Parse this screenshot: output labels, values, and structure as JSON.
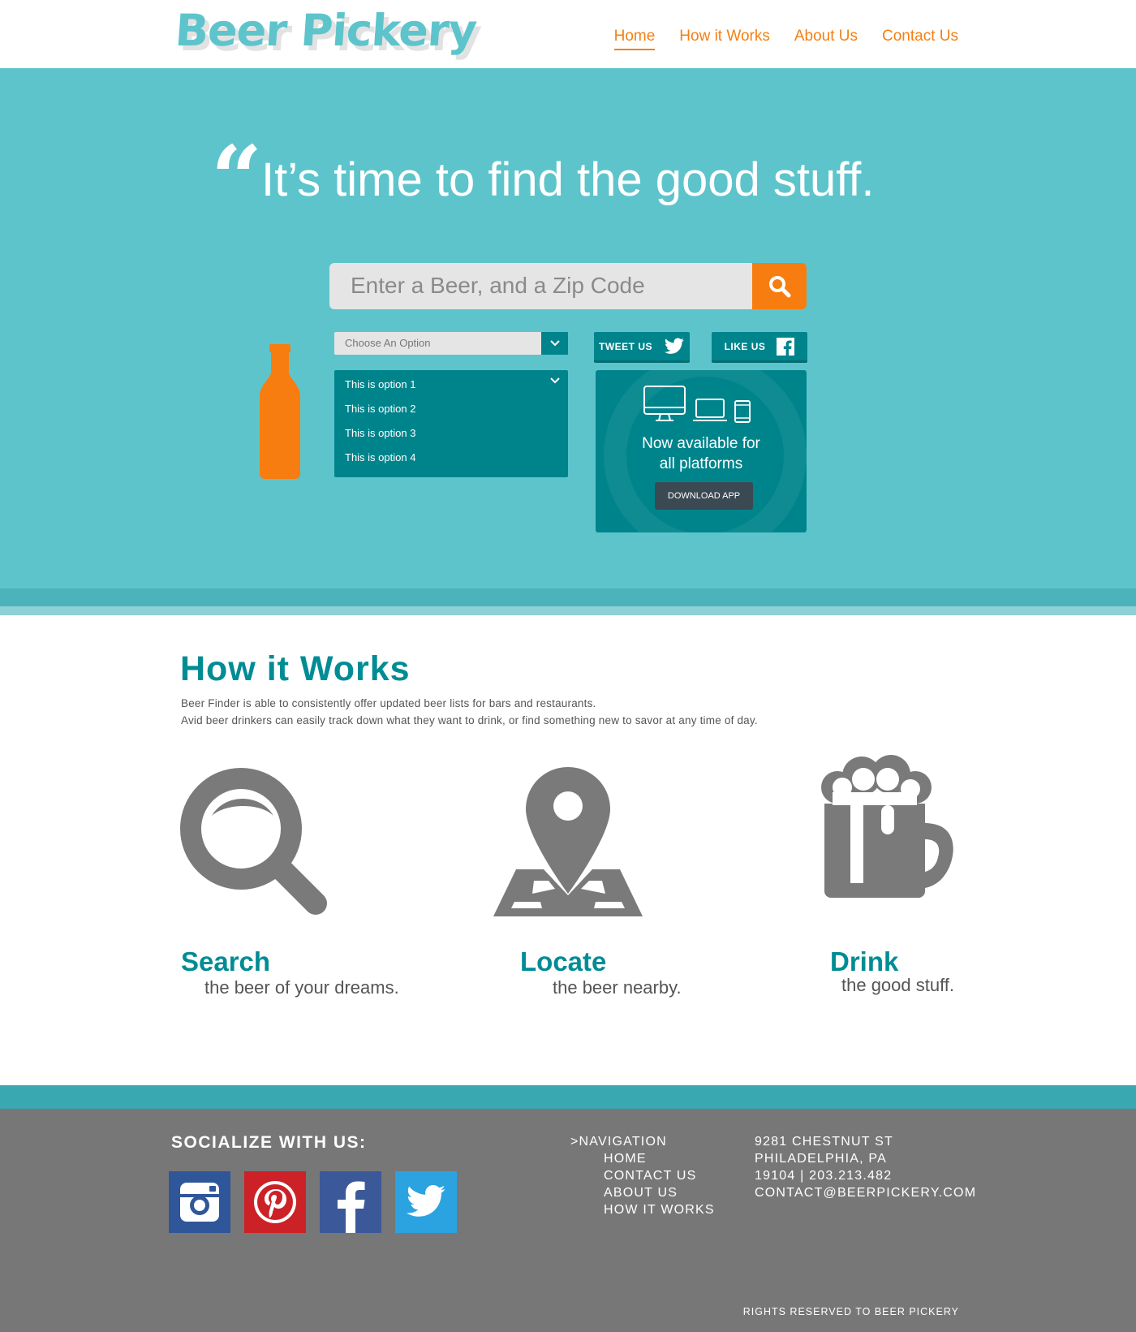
{
  "header": {
    "logo": "Beer Pickery",
    "nav": [
      {
        "label": "Home",
        "active": true
      },
      {
        "label": "How it Works",
        "active": false
      },
      {
        "label": "About Us",
        "active": false
      },
      {
        "label": "Contact Us",
        "active": false
      }
    ]
  },
  "hero": {
    "quote_mark": "“",
    "headline": "It’s time to find the good stuff.",
    "search": {
      "placeholder": "Enter a Beer, and a Zip Code",
      "button_icon": "search-icon"
    },
    "select": {
      "value": "Choose An Option"
    },
    "options": [
      "This is option 1",
      "This is option 2",
      "This is option 3",
      "This is option 4"
    ],
    "tweet_label": "TWEET US",
    "like_label": "LIKE US",
    "app_card": {
      "title_line1": "Now available for",
      "title_line2": "all platforms",
      "button": "DOWNLOAD APP"
    }
  },
  "how_it_works": {
    "title": "How it Works",
    "desc_line1": "Beer Finder is able to consistently offer updated beer lists for bars and restaurants.",
    "desc_line2": "Avid beer drinkers can easily track down what they want to drink, or find something new to savor at any time of day.",
    "steps": [
      {
        "title": "Search",
        "subtitle": "the beer of your dreams.",
        "icon": "magnifier-icon"
      },
      {
        "title": "Locate",
        "subtitle": "the beer nearby.",
        "icon": "map-pin-icon"
      },
      {
        "title": "Drink",
        "subtitle": "the good stuff.",
        "icon": "beer-mug-icon"
      }
    ]
  },
  "footer": {
    "socialize": "SOCIALIZE WITH US:",
    "social_icons": [
      "instagram-icon",
      "pinterest-icon",
      "facebook-icon",
      "twitter-icon"
    ],
    "nav_heading": ">NAVIGATION",
    "nav_links": [
      "HOME",
      "CONTACT US",
      "ABOUT US",
      "HOW IT WORKS"
    ],
    "address": [
      "9281 CHESTNUT ST",
      "PHILADELPHIA, PA",
      "19104 | 203.213.482",
      "CONTACT@BEERPICKERY.COM"
    ],
    "rights": "RIGHTS RESERVED TO BEER PICKERY"
  },
  "colors": {
    "teal": "#5ec4cc",
    "dark_teal": "#00848c",
    "orange": "#f77d10",
    "gray": "#777777"
  }
}
